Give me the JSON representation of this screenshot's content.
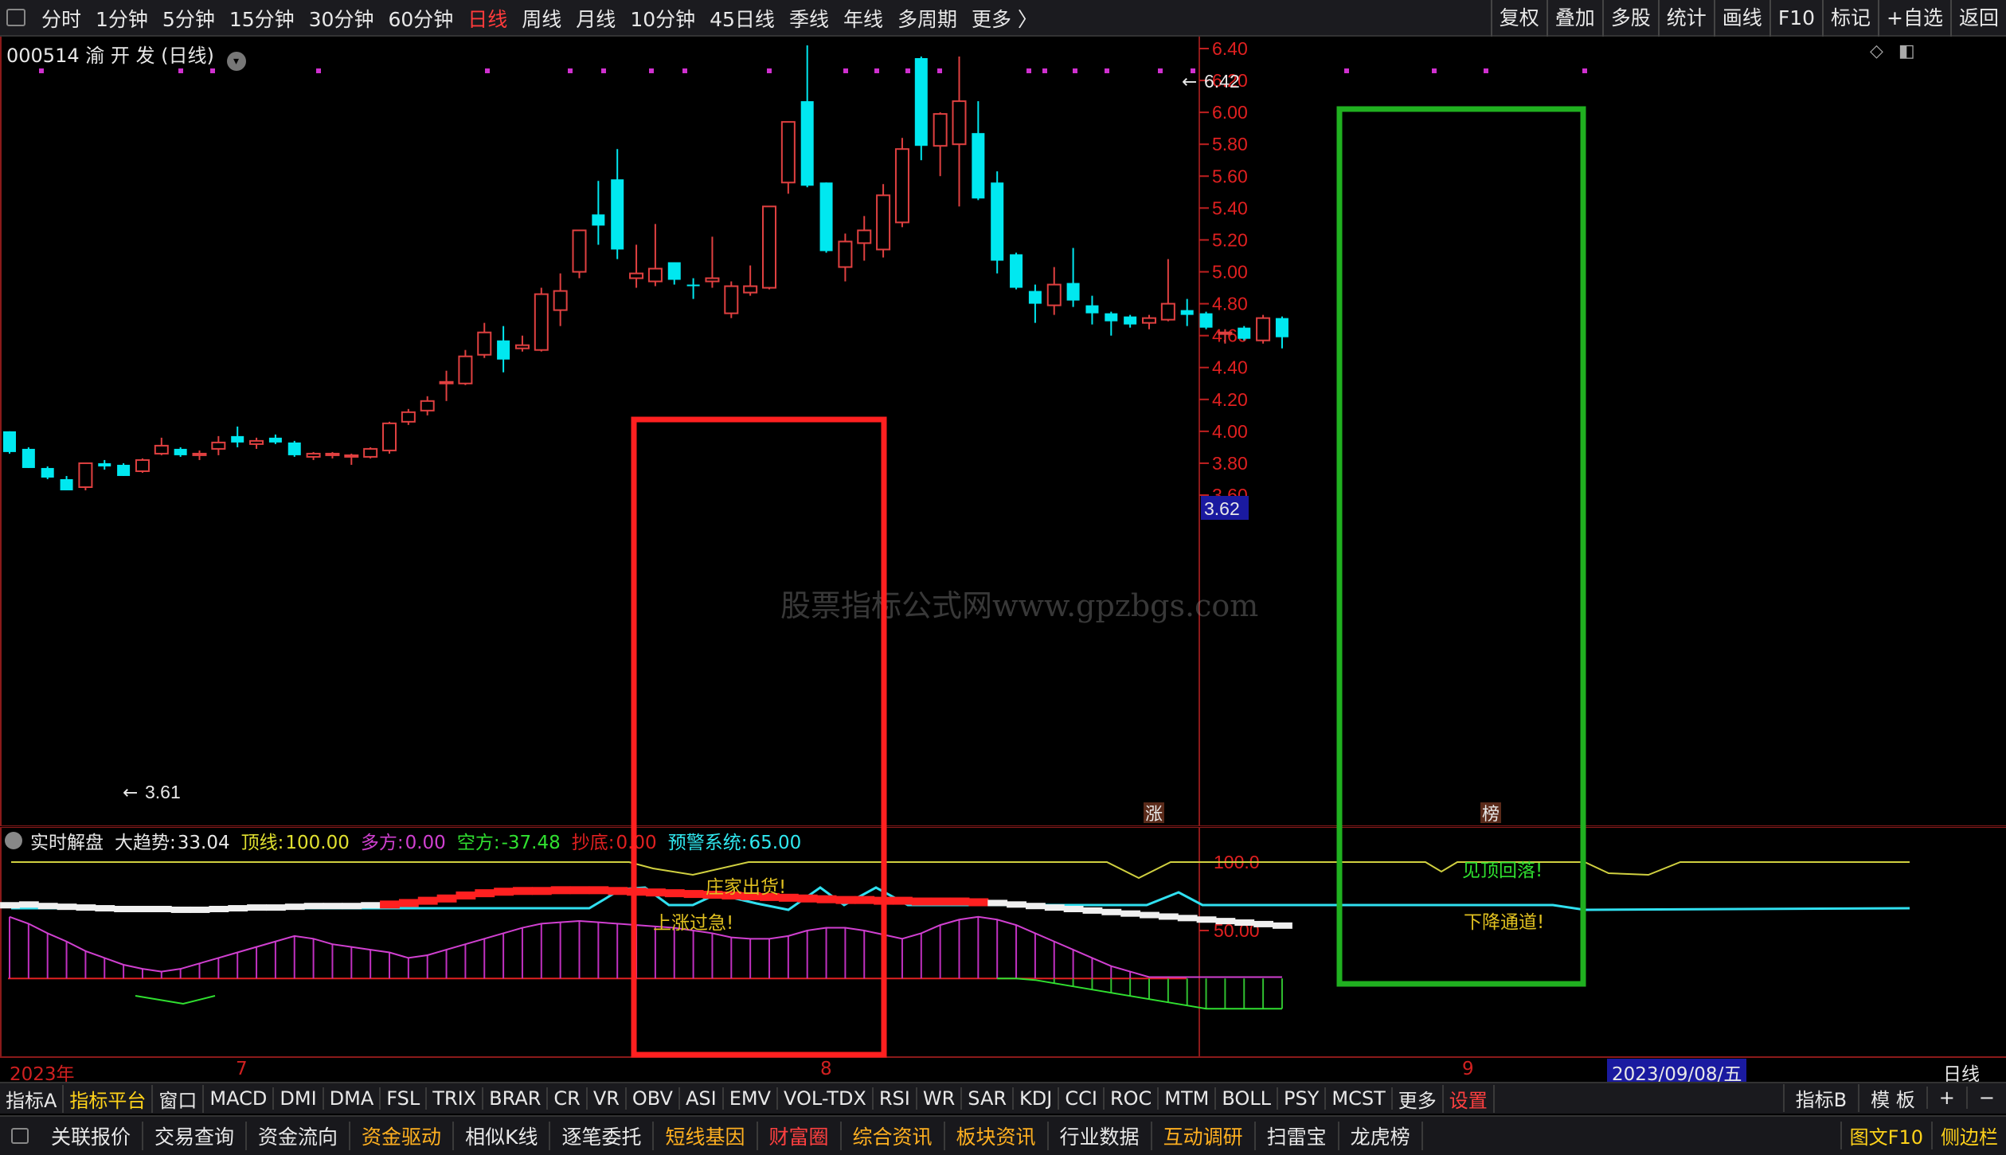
{
  "period_tabs": {
    "items": [
      "分时",
      "1分钟",
      "5分钟",
      "15分钟",
      "30分钟",
      "60分钟",
      "日线",
      "周线",
      "月线",
      "10分钟",
      "45日线",
      "季线",
      "年线",
      "多周期",
      "更多 〉"
    ],
    "active": "日线"
  },
  "right_tools": [
    "复权",
    "叠加",
    "多股",
    "统计",
    "画线",
    "F10",
    "标记",
    "+自选",
    "返回"
  ],
  "stock": {
    "code": "000514",
    "name": "渝 开 发",
    "period": "(日线)"
  },
  "price_axis": {
    "ticks": [
      "6.40",
      "6.20",
      "6.00",
      "5.80",
      "5.60",
      "5.40",
      "5.20",
      "5.00",
      "4.80",
      "4.60",
      "4.40",
      "4.20",
      "4.00",
      "3.80",
      "3.60"
    ],
    "current": "3.62",
    "current_bg": "#1a1aa0"
  },
  "annotations": {
    "high_label": "6.42",
    "low_label": "3.61",
    "zhang_tag": "涨",
    "bang_tag": "榜"
  },
  "watermark": "股票指标公式网www.gpzbgs.com",
  "chart_data": {
    "type": "candlestick",
    "ylim": [
      3.6,
      6.44
    ],
    "up_color": "#e04040",
    "down_color": "#00e8f0",
    "candles": [
      {
        "o": 4.0,
        "h": 4.0,
        "l": 3.86,
        "c": 3.87
      },
      {
        "o": 3.89,
        "h": 3.9,
        "l": 3.77,
        "c": 3.77
      },
      {
        "o": 3.77,
        "h": 3.78,
        "l": 3.7,
        "c": 3.71
      },
      {
        "o": 3.7,
        "h": 3.72,
        "l": 3.63,
        "c": 3.63
      },
      {
        "o": 3.65,
        "h": 3.8,
        "l": 3.63,
        "c": 3.8
      },
      {
        "o": 3.8,
        "h": 3.82,
        "l": 3.76,
        "c": 3.78
      },
      {
        "o": 3.79,
        "h": 3.8,
        "l": 3.72,
        "c": 3.72
      },
      {
        "o": 3.75,
        "h": 3.83,
        "l": 3.74,
        "c": 3.82
      },
      {
        "o": 3.86,
        "h": 3.96,
        "l": 3.85,
        "c": 3.91
      },
      {
        "o": 3.89,
        "h": 3.9,
        "l": 3.84,
        "c": 3.85
      },
      {
        "o": 3.85,
        "h": 3.88,
        "l": 3.82,
        "c": 3.86
      },
      {
        "o": 3.89,
        "h": 3.97,
        "l": 3.85,
        "c": 3.93
      },
      {
        "o": 3.97,
        "h": 4.03,
        "l": 3.9,
        "c": 3.93
      },
      {
        "o": 3.92,
        "h": 3.96,
        "l": 3.89,
        "c": 3.94
      },
      {
        "o": 3.96,
        "h": 3.98,
        "l": 3.92,
        "c": 3.93
      },
      {
        "o": 3.93,
        "h": 3.94,
        "l": 3.84,
        "c": 3.85
      },
      {
        "o": 3.84,
        "h": 3.87,
        "l": 3.82,
        "c": 3.86
      },
      {
        "o": 3.85,
        "h": 3.87,
        "l": 3.83,
        "c": 3.86
      },
      {
        "o": 3.84,
        "h": 3.86,
        "l": 3.79,
        "c": 3.85
      },
      {
        "o": 3.84,
        "h": 3.9,
        "l": 3.83,
        "c": 3.89
      },
      {
        "o": 3.88,
        "h": 4.06,
        "l": 3.86,
        "c": 4.05
      },
      {
        "o": 4.06,
        "h": 4.14,
        "l": 4.04,
        "c": 4.12
      },
      {
        "o": 4.13,
        "h": 4.22,
        "l": 4.1,
        "c": 4.19
      },
      {
        "o": 4.31,
        "h": 4.38,
        "l": 4.19,
        "c": 4.31
      },
      {
        "o": 4.3,
        "h": 4.51,
        "l": 4.29,
        "c": 4.47
      },
      {
        "o": 4.48,
        "h": 4.68,
        "l": 4.46,
        "c": 4.62
      },
      {
        "o": 4.57,
        "h": 4.66,
        "l": 4.37,
        "c": 4.45
      },
      {
        "o": 4.52,
        "h": 4.6,
        "l": 4.5,
        "c": 4.54
      },
      {
        "o": 4.51,
        "h": 4.9,
        "l": 4.5,
        "c": 4.86
      },
      {
        "o": 4.76,
        "h": 4.99,
        "l": 4.66,
        "c": 4.88
      },
      {
        "o": 5.0,
        "h": 5.15,
        "l": 4.96,
        "c": 5.26
      },
      {
        "o": 5.36,
        "h": 5.57,
        "l": 5.17,
        "c": 5.29
      },
      {
        "o": 5.58,
        "h": 5.77,
        "l": 5.08,
        "c": 5.14
      },
      {
        "o": 4.96,
        "h": 5.17,
        "l": 4.9,
        "c": 4.99
      },
      {
        "o": 4.94,
        "h": 5.3,
        "l": 4.91,
        "c": 5.02
      },
      {
        "o": 5.06,
        "h": 5.06,
        "l": 4.92,
        "c": 4.95
      },
      {
        "o": 4.92,
        "h": 4.96,
        "l": 4.83,
        "c": 4.91
      },
      {
        "o": 4.94,
        "h": 5.22,
        "l": 4.9,
        "c": 4.96
      },
      {
        "o": 4.74,
        "h": 4.94,
        "l": 4.71,
        "c": 4.91
      },
      {
        "o": 4.87,
        "h": 5.04,
        "l": 4.85,
        "c": 4.91
      },
      {
        "o": 4.9,
        "h": 5.41,
        "l": 4.89,
        "c": 5.41
      },
      {
        "o": 5.56,
        "h": 5.94,
        "l": 5.49,
        "c": 5.94
      },
      {
        "o": 6.07,
        "h": 6.42,
        "l": 5.53,
        "c": 5.54
      },
      {
        "o": 5.56,
        "h": 5.56,
        "l": 5.12,
        "c": 5.13
      },
      {
        "o": 5.03,
        "h": 5.24,
        "l": 4.94,
        "c": 5.19
      },
      {
        "o": 5.18,
        "h": 5.35,
        "l": 5.07,
        "c": 5.26
      },
      {
        "o": 5.14,
        "h": 5.55,
        "l": 5.09,
        "c": 5.48
      },
      {
        "o": 5.31,
        "h": 5.84,
        "l": 5.28,
        "c": 5.77
      },
      {
        "o": 6.34,
        "h": 6.35,
        "l": 5.7,
        "c": 5.79
      },
      {
        "o": 5.79,
        "h": 6.0,
        "l": 5.6,
        "c": 5.99
      },
      {
        "o": 5.8,
        "h": 6.35,
        "l": 5.41,
        "c": 6.07
      },
      {
        "o": 5.87,
        "h": 6.07,
        "l": 5.45,
        "c": 5.46
      },
      {
        "o": 5.56,
        "h": 5.63,
        "l": 4.99,
        "c": 5.07
      },
      {
        "o": 5.11,
        "h": 5.12,
        "l": 4.89,
        "c": 4.9
      },
      {
        "o": 4.88,
        "h": 4.92,
        "l": 4.68,
        "c": 4.8
      },
      {
        "o": 4.79,
        "h": 5.03,
        "l": 4.73,
        "c": 4.92
      },
      {
        "o": 4.93,
        "h": 5.15,
        "l": 4.78,
        "c": 4.82
      },
      {
        "o": 4.79,
        "h": 4.85,
        "l": 4.67,
        "c": 4.74
      },
      {
        "o": 4.74,
        "h": 4.75,
        "l": 4.6,
        "c": 4.69
      },
      {
        "o": 4.72,
        "h": 4.73,
        "l": 4.65,
        "c": 4.67
      },
      {
        "o": 4.68,
        "h": 4.73,
        "l": 4.64,
        "c": 4.71
      },
      {
        "o": 4.7,
        "h": 5.08,
        "l": 4.69,
        "c": 4.8
      },
      {
        "o": 4.76,
        "h": 4.83,
        "l": 4.66,
        "c": 4.73
      },
      {
        "o": 4.74,
        "h": 4.75,
        "l": 4.64,
        "c": 4.65
      },
      {
        "o": 4.62,
        "h": 4.64,
        "l": 4.55,
        "c": 4.62
      },
      {
        "o": 4.65,
        "h": 4.66,
        "l": 4.57,
        "c": 4.58
      },
      {
        "o": 4.57,
        "h": 4.73,
        "l": 4.55,
        "c": 4.71
      },
      {
        "o": 4.71,
        "h": 4.72,
        "l": 4.52,
        "c": 4.59
      }
    ]
  },
  "indicator": {
    "name": "实时解盘",
    "items": [
      {
        "label": "大趋势:",
        "value": "33.04",
        "color": "#e8e8e8"
      },
      {
        "label": "顶线:",
        "value": "100.00",
        "color": "#e0e030"
      },
      {
        "label": "多方:",
        "value": "0.00",
        "color": "#d040d0"
      },
      {
        "label": "空方:",
        "value": "-37.48",
        "color": "#30e030"
      },
      {
        "label": "抄底:",
        "value": "0.00",
        "color": "#e02020"
      },
      {
        "label": "预警系统:",
        "value": "65.00",
        "color": "#30e8f0"
      }
    ],
    "axis_ticks": [
      "100.0",
      "50.00"
    ],
    "labels": {
      "zhuangjia": "庄家出货!",
      "shangzhang": "上涨过急!",
      "gaowei": "见顶回落!",
      "xiajiang": "下降通道!"
    }
  },
  "date_axis": {
    "year": "2023年",
    "m7": "7",
    "m8": "8",
    "m9": "9",
    "cursor": "2023/09/08/五",
    "period": "日线"
  },
  "indicator_tabs": [
    "指标A",
    "指标平台",
    "窗口",
    "MACD",
    "DMI",
    "DMA",
    "FSL",
    "TRIX",
    "BRAR",
    "CR",
    "VR",
    "OBV",
    "ASI",
    "EMV",
    "VOL-TDX",
    "RSI",
    "WR",
    "SAR",
    "KDJ",
    "CCI",
    "ROC",
    "MTM",
    "BOLL",
    "PSY",
    "MCST",
    "更多",
    "设置"
  ],
  "indicator_tabs_right": [
    "指标B",
    "模 板",
    "+",
    "−"
  ],
  "bottom_functions": [
    {
      "label": "关联报价",
      "color": "#e8e8e8"
    },
    {
      "label": "交易查询",
      "color": "#e8e8e8"
    },
    {
      "label": "资金流向",
      "color": "#e8e8e8"
    },
    {
      "label": "资金驱动",
      "color": "#ffb020"
    },
    {
      "label": "相似K线",
      "color": "#e8e8e8"
    },
    {
      "label": "逐笔委托",
      "color": "#e8e8e8"
    },
    {
      "label": "短线基因",
      "color": "#ffb020"
    },
    {
      "label": "财富圈",
      "color": "#ff4040"
    },
    {
      "label": "综合资讯",
      "color": "#ffb020"
    },
    {
      "label": "板块资讯",
      "color": "#ffb020"
    },
    {
      "label": "行业数据",
      "color": "#e8e8e8"
    },
    {
      "label": "互动调研",
      "color": "#ffb020"
    },
    {
      "label": "扫雷宝",
      "color": "#e8e8e8"
    },
    {
      "label": "龙虎榜",
      "color": "#e8e8e8"
    }
  ],
  "bottom_right": [
    "图文F10",
    "侧边栏"
  ]
}
